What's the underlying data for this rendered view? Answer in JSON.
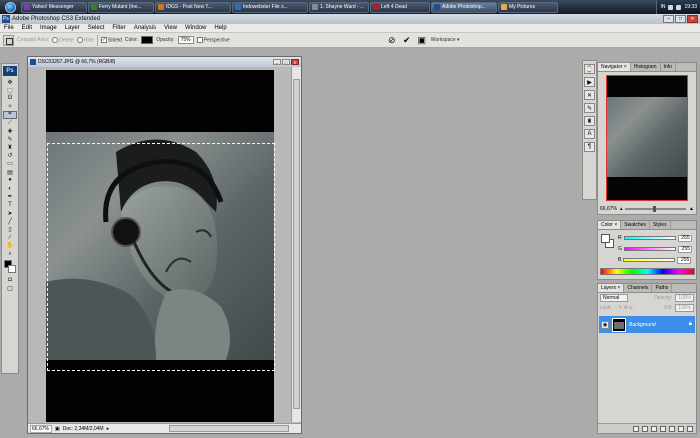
{
  "taskbar": {
    "items": [
      {
        "label": "Yahoo! Messenger",
        "color": "#7b3ea8"
      },
      {
        "label": "Ferry Mutant (Ine...",
        "color": "#3c7d2c"
      },
      {
        "label": "IDGS - Post New T...",
        "color": "#c47a1b"
      },
      {
        "label": "Indowebster File s...",
        "color": "#2f6db5"
      },
      {
        "label": "1. Shayne Ward - ...",
        "color": "#8a8a8a"
      },
      {
        "label": "Left 4 Dead",
        "color": "#b02020"
      },
      {
        "label": "Adobe Photoshop...",
        "color": "#1e4f8f"
      },
      {
        "label": "My Pictures",
        "color": "#e0b040"
      }
    ],
    "tray_lang": "IN",
    "clock": "19:33"
  },
  "app": {
    "title": "Adobe Photoshop CS3 Extended",
    "ps_label": "Ps"
  },
  "menu": [
    "File",
    "Edit",
    "Image",
    "Layer",
    "Select",
    "Filter",
    "Analysis",
    "View",
    "Window",
    "Help"
  ],
  "options": {
    "cropped_area": "Cropped Area:",
    "delete": "Delete",
    "hide": "Hide",
    "shield": "Shield",
    "color_label": "Color:",
    "opacity_label": "Opacity:",
    "opacity_value": "75%",
    "perspective": "Perspective",
    "workspace": "Workspace ▾",
    "cancel_glyph": "⊘",
    "commit_glyph": "✔"
  },
  "document": {
    "title": "DSC03267.JPG @ 66,7% (RGB/8)",
    "zoom": "66,67%",
    "doc_info": "Doc: 2,34M/2,04M"
  },
  "navigator": {
    "tabs": [
      "Navigator ×",
      "Histogram",
      "Info"
    ],
    "zoom": "66,67%"
  },
  "color_panel": {
    "tabs": [
      "Color ×",
      "Swatches",
      "Styles"
    ],
    "channels": [
      {
        "name": "R",
        "value": "255",
        "gradient": "linear-gradient(90deg,#00ffff,#ffffff)"
      },
      {
        "name": "G",
        "value": "255",
        "gradient": "linear-gradient(90deg,#ff00ff,#ffffff)"
      },
      {
        "name": "B",
        "value": "255",
        "gradient": "linear-gradient(90deg,#ffff00,#ffffff)"
      }
    ]
  },
  "layers_panel": {
    "tabs": [
      "Layers ×",
      "Channels",
      "Paths"
    ],
    "blend_mode": "Normal",
    "opacity_label": "Opacity:",
    "opacity_value": "100%",
    "lock_label": "Lock:",
    "fill_label": "Fill:",
    "fill_value": "100%",
    "layer_name": "Background"
  },
  "colors": {
    "accent": "#3c8ee8",
    "taskbar": "#1e2a3a"
  }
}
